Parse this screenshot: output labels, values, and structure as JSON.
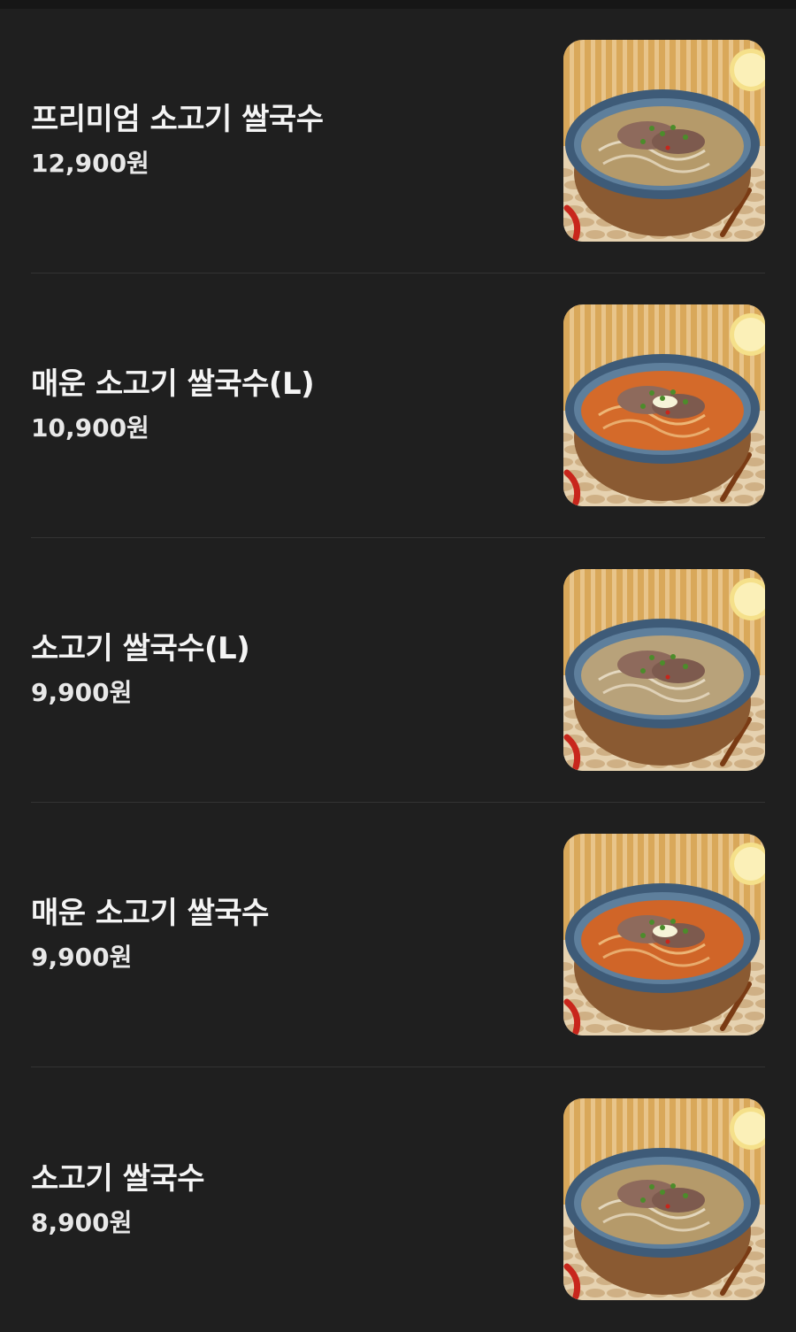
{
  "menu": {
    "items": [
      {
        "name": "프리미엄 소고기 쌀국수",
        "price": "12,900원",
        "broth": "clear",
        "broth_color": "#b59a6a"
      },
      {
        "name": "매운 소고기 쌀국수(L)",
        "price": "10,900원",
        "broth": "spicy",
        "broth_color": "#d46a2a"
      },
      {
        "name": "소고기 쌀국수(L)",
        "price": "9,900원",
        "broth": "clear",
        "broth_color": "#b8a27a"
      },
      {
        "name": "매운 소고기 쌀국수",
        "price": "9,900원",
        "broth": "spicy",
        "broth_color": "#d06528"
      },
      {
        "name": "소고기 쌀국수",
        "price": "8,900원",
        "broth": "clear",
        "broth_color": "#b59a6a"
      }
    ]
  },
  "icons": {
    "thumbnail": "pho-bowl-image"
  },
  "colors": {
    "background": "#1f1f1f",
    "divider": "#333333",
    "text": "#f4f4f4"
  }
}
